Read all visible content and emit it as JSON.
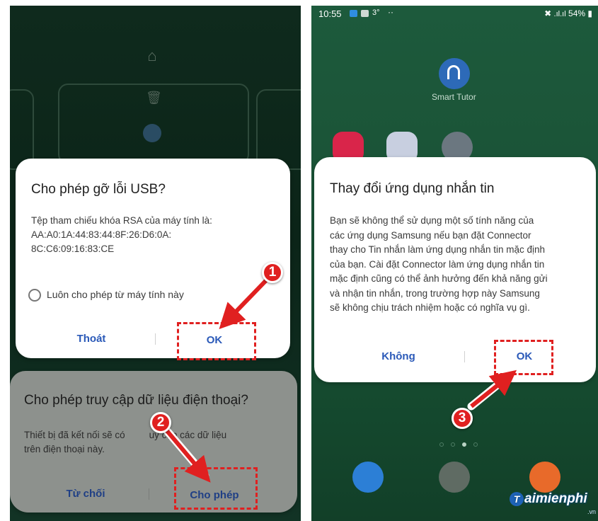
{
  "left": {
    "usb_dialog": {
      "title": "Cho phép gỡ lỗi USB?",
      "body_line1": "Tệp tham chiếu khóa RSA của máy tính là:",
      "body_line2": "AA:A0:1A:44:83:44:8F:26:D6:0A:",
      "body_line3": "8C:C6:09:16:83:CE",
      "checkbox_label": "Luôn cho phép từ máy tính này",
      "cancel_label": "Thoát",
      "ok_label": "OK"
    },
    "access_dialog": {
      "title": "Cho phép truy cập dữ liệu điện thoại?",
      "body_line1a": "Thiết bị đã kết nối sẽ có",
      "body_line1b": "uy cập các dữ liệu",
      "body_line2": "trên điện thoại này.",
      "deny_label": "Từ chối",
      "allow_label": "Cho phép"
    },
    "step_badges": [
      "1",
      "2"
    ]
  },
  "right": {
    "status_bar": {
      "time": "10:55",
      "temp": "3°",
      "battery": "54%"
    },
    "home": {
      "top_app_label": "Smart Tutor"
    },
    "sms_dialog": {
      "title": "Thay đổi ứng dụng nhắn tin",
      "body_lines": [
        "Bạn sẽ không thể sử dụng một số tính năng của",
        "các ứng dụng Samsung nếu bạn đặt Connector",
        "thay cho Tin nhắn làm ứng dụng nhắn tin mặc định",
        "của bạn. Cài đặt Connector làm ứng dụng nhắn tin",
        "mặc định cũng có thể ảnh hưởng đến khả năng gửi",
        "và nhận tin nhắn, trong trường hợp này Samsung",
        "sẽ không chịu trách nhiệm hoặc có nghĩa vụ gì."
      ],
      "cancel_label": "Không",
      "ok_label": "OK"
    },
    "step_badge": "3",
    "watermark": {
      "letter": "T",
      "text": "aimienphi",
      "suffix": ".vn"
    }
  },
  "colors": {
    "accent_blue": "#2a59b8",
    "annotation_red": "#e02020",
    "left_bg": "#0f2a1d",
    "right_bg": "#1a5236"
  }
}
